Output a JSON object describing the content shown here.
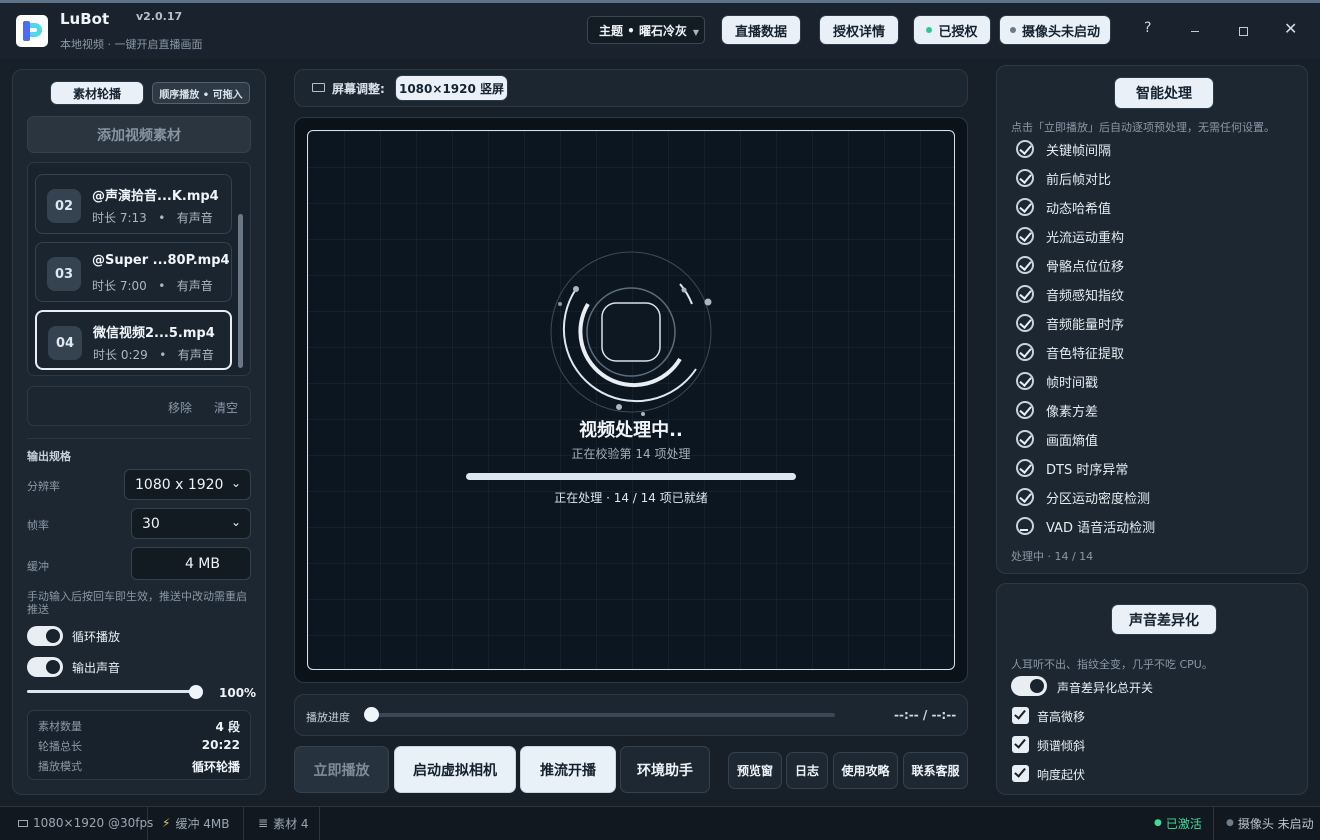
{
  "app": {
    "name": "LuBot",
    "version": "v2.0.17",
    "subtitle": "本地视频 · 一键开启直播画面"
  },
  "topbar": {
    "theme": "主题 • 曜石冷灰",
    "live_data": "直播数据",
    "auth_details": "授权详情",
    "authorized": "已授权",
    "camera": "摄像头未启动",
    "help": "?"
  },
  "left": {
    "tab_active": "素材轮播",
    "tab_mode": "顺序播放 • 可拖入",
    "add": "添加视频素材",
    "items": [
      {
        "num": "02",
        "name": "@声演拾音...K.mp4",
        "duration": "时长 7:13",
        "sound": "有声音"
      },
      {
        "num": "03",
        "name": "@Super ...80P.mp4",
        "duration": "时长 7:00",
        "sound": "有声音"
      },
      {
        "num": "04",
        "name": "微信视频2...5.mp4",
        "duration": "时长 0:29",
        "sound": "有声音"
      }
    ],
    "remove": "移除",
    "clear": "清空",
    "output_title": "输出规格",
    "res_label": "分辨率",
    "res_value": "1080 x 1920",
    "fps_label": "帧率",
    "fps_value": "30",
    "buffer_label": "缓冲",
    "buffer_value": "4 MB",
    "hint": "手动输入后按回车即生效，推送中改动需重启推送",
    "loop": "循环播放",
    "audio": "输出声音",
    "volume": "100%",
    "volume_level": 0.96,
    "stats": [
      {
        "label": "素材数量",
        "value": "4 段"
      },
      {
        "label": "轮播总长",
        "value": "20:22"
      },
      {
        "label": "播放模式",
        "value": "循环轮播"
      }
    ]
  },
  "center": {
    "screen_label": "屏幕调整:",
    "screen_value": "1080×1920 竖屏",
    "processing": "视频处理中..",
    "checking": "正在校验第 14 项处理",
    "progress_text": "正在处理 · 14 / 14 项已就绪",
    "progress": 1.0,
    "playback_label": "播放进度",
    "time": "--:-- / --:--",
    "playback_progress": 0.0,
    "play_now": "立即播放",
    "virtual_cam": "启动虚拟相机",
    "stream": "推流开播",
    "assistant": "环境助手",
    "preview": "预览窗",
    "log": "日志",
    "guide": "使用攻略",
    "support": "联系客服"
  },
  "right": {
    "smart_title": "智能处理",
    "smart_desc": "点击「立即播放」后自动逐项预处理，无需任何设置。",
    "checks": [
      "关键帧间隔",
      "前后帧对比",
      "动态哈希值",
      "光流运动重构",
      "骨骼点位位移",
      "音频感知指纹",
      "音频能量时序",
      "音色特征提取",
      "帧时间戳",
      "像素方差",
      "画面熵值",
      "DTS 时序异常",
      "分区运动密度检测",
      "VAD 语音活动检测"
    ],
    "smart_status": "处理中 · 14 / 14",
    "audio_title": "声音差异化",
    "audio_desc": "人耳听不出、指纹全变，几乎不吃 CPU。",
    "audio_master": "声音差异化总开关",
    "audio_opts": [
      "音高微移",
      "频谱倾斜",
      "响度起伏"
    ]
  },
  "status": {
    "resolution": "1080×1920 @30fps",
    "buffer": "缓冲 4MB",
    "count": "素材 4",
    "activated": "已激活",
    "camera": "摄像头 未启动"
  },
  "colors": {
    "accent": "#3ddc97",
    "panel": "#1b2631",
    "bg": "#172029"
  }
}
